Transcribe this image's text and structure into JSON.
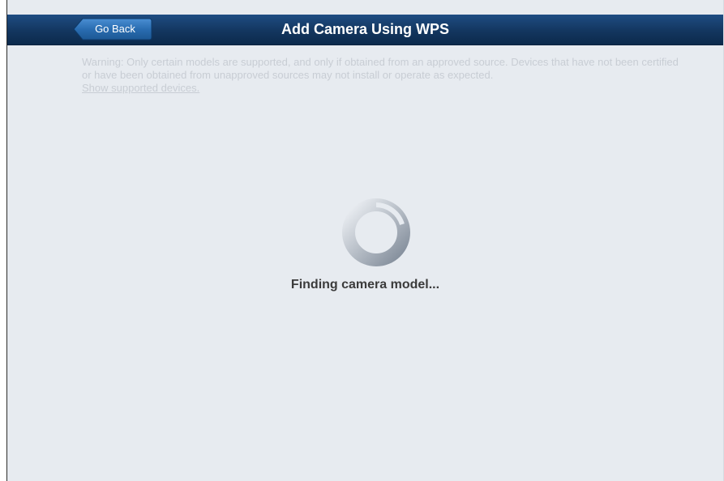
{
  "header": {
    "back_label": "Go Back",
    "title": "Add Camera Using WPS",
    "background": "#13365f",
    "back_button_color": "#2a6db1"
  },
  "warning": {
    "text": "Warning: Only certain models are supported, and only if obtained from an approved source. Devices that have not been certified or have been obtained from unapproved sources may not install or operate as expected.",
    "link_label": "Show supported devices."
  },
  "status": {
    "message": "Finding camera model...",
    "icon": "loading-spinner-icon"
  },
  "colors": {
    "page_background": "#e7ebf0",
    "warning_text": "#c8cdd4",
    "status_text": "#3b3b3b"
  }
}
